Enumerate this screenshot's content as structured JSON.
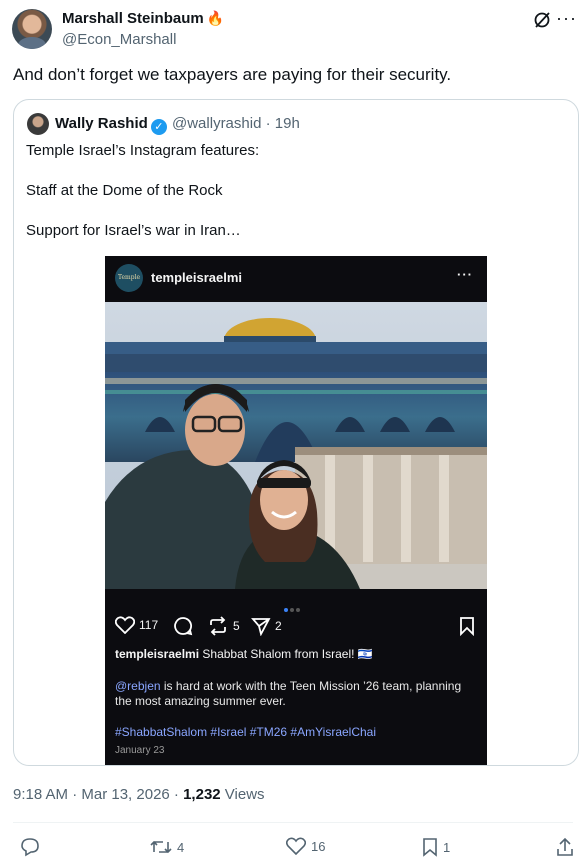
{
  "author": {
    "name": "Marshall Steinbaum",
    "emoji": "🔥",
    "handle": "@Econ_Marshall"
  },
  "tweet_text": "And don’t forget we taxpayers are paying for their security.",
  "quote": {
    "name": "Wally Rashid",
    "handle": "@wallyrashid",
    "time": "· 19h",
    "lines": [
      "Temple Israel’s Instagram features:",
      "Staff at the Dome of the Rock",
      "Support for Israel’s war in Iran…"
    ]
  },
  "instagram": {
    "avatar_text": "Temple Israel",
    "username": "templeisraelmi",
    "likes": "117",
    "reposts": "5",
    "shares": "2",
    "caption_user": "templeisraelmi",
    "caption_text": "Shabbat Shalom from Israel! 🇮🇱",
    "mention": "@rebjen",
    "body": " is hard at work with the Teen Mission ’26 team, planning the most amazing summer ever.",
    "hashtags": "#ShabbatShalom #Israel #TM26 #AmYisraelChai",
    "date": "January 23"
  },
  "meta": {
    "time": "9:18 AM · Mar 13, 2026 · ",
    "views_count": "1,232",
    "views_label": " Views"
  },
  "actions": {
    "retweets": "4",
    "likes": "16",
    "bookmarks": "1"
  }
}
